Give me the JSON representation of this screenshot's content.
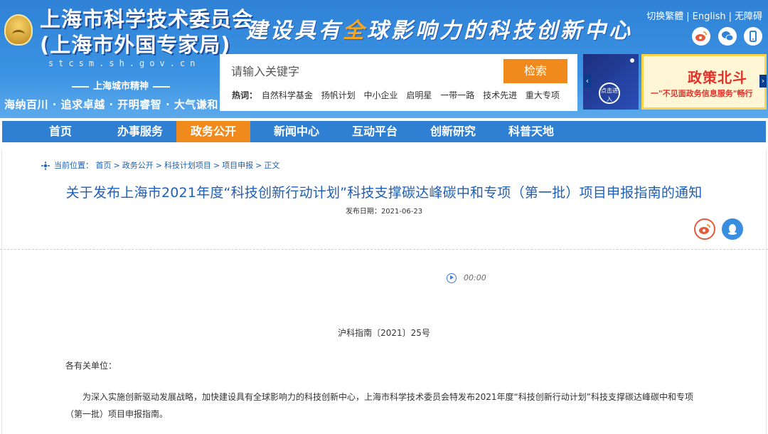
{
  "header": {
    "org_name_line1": "上海市科学技术委员会",
    "org_name_line2": "(上海市外国专家局)",
    "site_url": "stcsm.sh.gov.cn",
    "spirit_title": "上海城市精神",
    "spirit_text": "海纳百川 · 追求卓越 · 开明睿智 · 大气谦和",
    "slogan_part1": "建设具有",
    "slogan_highlight": "全",
    "slogan_part2": "球影响力的科技创新中心",
    "top_links": [
      "切换繁體",
      "English",
      "无障碍"
    ],
    "top_link_separator": "|",
    "social_icons": [
      "weibo-icon",
      "wechat-icon",
      "mobile-icon"
    ]
  },
  "search": {
    "placeholder": "请输入关键字",
    "button_label": "检索",
    "hot_label": "热词：",
    "hot_words": [
      "自然科学基金",
      "扬帆计划",
      "中小企业",
      "启明星",
      "一带一路",
      "技术先进",
      "重大专项"
    ]
  },
  "banners": {
    "a_text": "点击进入",
    "b_title": "政策北斗",
    "b_subtitle": "一\"不见面政务信息服务\"畅行"
  },
  "nav": {
    "items": [
      "首页",
      "办事服务",
      "政务公开",
      "新闻中心",
      "互动平台",
      "创新研究",
      "科普天地"
    ],
    "active_index": 2
  },
  "breadcrumb": {
    "label": "当前位置：",
    "items": [
      "首页",
      "政务公开",
      "科技计划项目",
      "项目申报",
      "正文"
    ],
    "separator": ">"
  },
  "article": {
    "title": "关于发布上海市2021年度“科技创新行动计划”科技支撑碳达峰碳中和专项（第一批）项目申报指南的通知",
    "pub_date_label": "发布日期：",
    "pub_date": "2021-06-23",
    "audio_time": "00:00",
    "doc_number": "沪科指南〔2021〕25号",
    "salutation": "各有关单位：",
    "paragraph1": "为深入实施创新驱动发展战略，加快建设具有全球影响力的科技创新中心，上海市科学技术委员会特发布2021年度“科技创新行动计划”科技支撑碳达峰碳中和专项（第一批）项目申报指南。"
  },
  "colors": {
    "header_blue": "#2f82d6",
    "nav_blue": "#2f7fd3",
    "accent_orange": "#f08a1d",
    "title_blue": "#1e5fb7"
  }
}
